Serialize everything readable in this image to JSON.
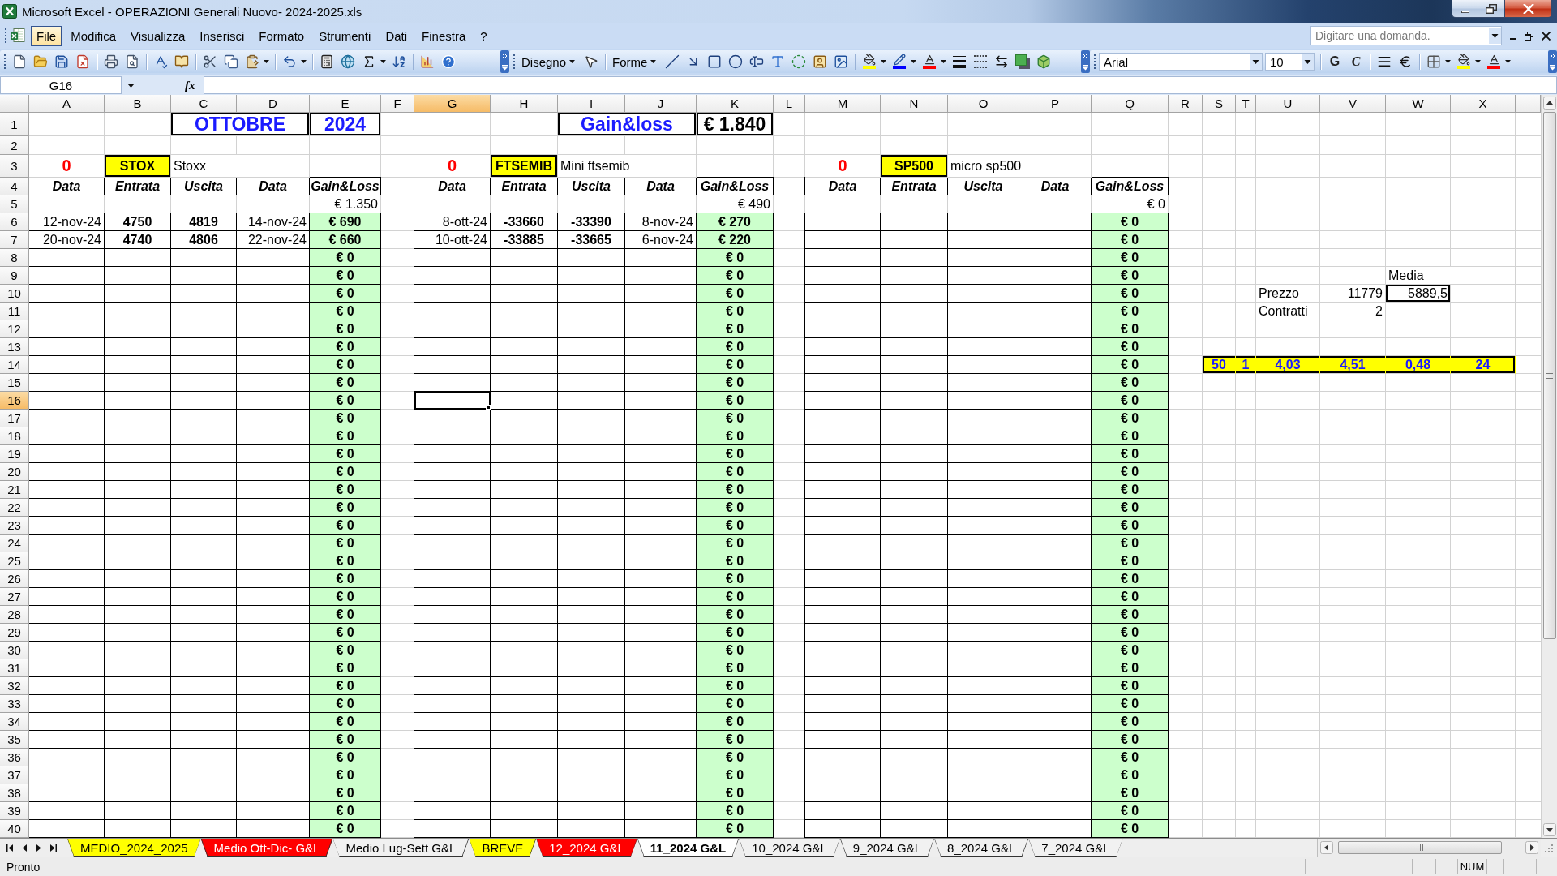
{
  "window": {
    "title": "Microsoft Excel - OPERAZIONI Generali Nuovo- 2024-2025.xls"
  },
  "menu": {
    "items": [
      {
        "label": "File",
        "selected": true
      },
      {
        "label": "Modifica",
        "selected": false
      },
      {
        "label": "Visualizza",
        "selected": false
      },
      {
        "label": "Inserisci",
        "selected": false
      },
      {
        "label": "Formato",
        "selected": false
      },
      {
        "label": "Strumenti",
        "selected": false
      },
      {
        "label": "Dati",
        "selected": false
      },
      {
        "label": "Finestra",
        "selected": false
      },
      {
        "label": "?",
        "selected": false
      }
    ],
    "help": {
      "placeholder": "Digitare una domanda."
    }
  },
  "drawing_toolbar": {
    "menus": [
      "Disegno",
      "Forme"
    ]
  },
  "formatting_toolbar": {
    "font": "Arial",
    "size": "10",
    "bold": "G",
    "italic": "C"
  },
  "formula_bar": {
    "name_box": "G16",
    "function_label": "fx"
  },
  "sheet": {
    "columns": [
      {
        "label": "A",
        "selected": false
      },
      {
        "label": "B",
        "selected": false
      },
      {
        "label": "C",
        "selected": false
      },
      {
        "label": "D",
        "selected": false
      },
      {
        "label": "E",
        "selected": false
      },
      {
        "label": "F",
        "selected": false
      },
      {
        "label": "G",
        "selected": true
      },
      {
        "label": "H",
        "selected": false
      },
      {
        "label": "I",
        "selected": false
      },
      {
        "label": "J",
        "selected": false
      },
      {
        "label": "K",
        "selected": false
      },
      {
        "label": "L",
        "selected": false
      },
      {
        "label": "M",
        "selected": false
      },
      {
        "label": "N",
        "selected": false
      },
      {
        "label": "O",
        "selected": false
      },
      {
        "label": "P",
        "selected": false
      },
      {
        "label": "Q",
        "selected": false
      },
      {
        "label": "R",
        "selected": false
      },
      {
        "label": "S",
        "selected": false
      },
      {
        "label": "T",
        "selected": false
      },
      {
        "label": "U",
        "selected": false
      },
      {
        "label": "V",
        "selected": false
      },
      {
        "label": "W",
        "selected": false
      },
      {
        "label": "X",
        "selected": false
      }
    ],
    "rows": [
      {
        "label": "1",
        "selected": false
      },
      {
        "label": "2",
        "selected": false
      },
      {
        "label": "3",
        "selected": false
      },
      {
        "label": "4",
        "selected": false
      },
      {
        "label": "5",
        "selected": false
      },
      {
        "label": "6",
        "selected": false
      },
      {
        "label": "7",
        "selected": false
      },
      {
        "label": "8",
        "selected": false
      },
      {
        "label": "9",
        "selected": false
      },
      {
        "label": "10",
        "selected": false
      },
      {
        "label": "11",
        "selected": false
      },
      {
        "label": "12",
        "selected": false
      },
      {
        "label": "13",
        "selected": false
      },
      {
        "label": "14",
        "selected": false
      },
      {
        "label": "15",
        "selected": false
      },
      {
        "label": "16",
        "selected": true
      },
      {
        "label": "17",
        "selected": false
      },
      {
        "label": "18",
        "selected": false
      },
      {
        "label": "19",
        "selected": false
      },
      {
        "label": "20",
        "selected": false
      },
      {
        "label": "21",
        "selected": false
      },
      {
        "label": "22",
        "selected": false
      },
      {
        "label": "23",
        "selected": false
      },
      {
        "label": "24",
        "selected": false
      },
      {
        "label": "25",
        "selected": false
      },
      {
        "label": "26",
        "selected": false
      },
      {
        "label": "27",
        "selected": false
      },
      {
        "label": "28",
        "selected": false
      },
      {
        "label": "29",
        "selected": false
      },
      {
        "label": "30",
        "selected": false
      },
      {
        "label": "31",
        "selected": false
      },
      {
        "label": "32",
        "selected": false
      },
      {
        "label": "33",
        "selected": false
      },
      {
        "label": "34",
        "selected": false
      },
      {
        "label": "35",
        "selected": false
      },
      {
        "label": "36",
        "selected": false
      },
      {
        "label": "37",
        "selected": false
      },
      {
        "label": "38",
        "selected": false
      },
      {
        "label": "39",
        "selected": false
      },
      {
        "label": "40",
        "selected": false
      }
    ],
    "header": {
      "month": "OTTOBRE",
      "year": "2024",
      "label": "Gain&loss",
      "total": "€ 1.840"
    },
    "tables": [
      {
        "count": "0",
        "ticker": "STOX",
        "name": "Stoxx",
        "headings": [
          "Data",
          "Entrata",
          "Uscita",
          "Data",
          "Gain&Loss"
        ],
        "total": "€ 1.350",
        "rows": [
          {
            "open_date": "12-nov-24",
            "entry": "4750",
            "exit": "4819",
            "close_date": "14-nov-24",
            "result": "€ 690"
          },
          {
            "open_date": "20-nov-24",
            "entry": "4740",
            "exit": "4806",
            "close_date": "22-nov-24",
            "result": "€ 660"
          },
          {
            "result": "€ 0"
          },
          {
            "result": "€ 0"
          },
          {
            "result": "€ 0"
          },
          {
            "result": "€ 0"
          },
          {
            "result": "€ 0"
          },
          {
            "result": "€ 0"
          },
          {
            "result": "€ 0"
          },
          {
            "result": "€ 0"
          },
          {
            "result": "€ 0"
          },
          {
            "result": "€ 0"
          },
          {
            "result": "€ 0"
          },
          {
            "result": "€ 0"
          },
          {
            "result": "€ 0"
          },
          {
            "result": "€ 0"
          },
          {
            "result": "€ 0"
          },
          {
            "result": "€ 0"
          },
          {
            "result": "€ 0"
          },
          {
            "result": "€ 0"
          },
          {
            "result": "€ 0"
          },
          {
            "result": "€ 0"
          },
          {
            "result": "€ 0"
          },
          {
            "result": "€ 0"
          },
          {
            "result": "€ 0"
          },
          {
            "result": "€ 0"
          },
          {
            "result": "€ 0"
          },
          {
            "result": "€ 0"
          },
          {
            "result": "€ 0"
          },
          {
            "result": "€ 0"
          },
          {
            "result": "€ 0"
          },
          {
            "result": "€ 0"
          },
          {
            "result": "€ 0"
          },
          {
            "result": "€ 0"
          },
          {
            "result": "€ 0"
          }
        ]
      },
      {
        "count": "0",
        "ticker": "FTSEMIB",
        "name": "Mini ftsemib",
        "headings": [
          "Data",
          "Entrata",
          "Uscita",
          "Data",
          "Gain&Loss"
        ],
        "total": "€ 490",
        "rows": [
          {
            "open_date": "8-ott-24",
            "entry": "-33660",
            "exit": "-33390",
            "close_date": "8-nov-24",
            "result": "€ 270"
          },
          {
            "open_date": "10-ott-24",
            "entry": "-33885",
            "exit": "-33665",
            "close_date": "6-nov-24",
            "result": "€ 220"
          },
          {
            "result": "€ 0"
          },
          {
            "result": "€ 0"
          },
          {
            "result": "€ 0"
          },
          {
            "result": "€ 0"
          },
          {
            "result": "€ 0"
          },
          {
            "result": "€ 0"
          },
          {
            "result": "€ 0"
          },
          {
            "result": "€ 0"
          },
          {
            "result": "€ 0"
          },
          {
            "result": "€ 0"
          },
          {
            "result": "€ 0"
          },
          {
            "result": "€ 0"
          },
          {
            "result": "€ 0"
          },
          {
            "result": "€ 0"
          },
          {
            "result": "€ 0"
          },
          {
            "result": "€ 0"
          },
          {
            "result": "€ 0"
          },
          {
            "result": "€ 0"
          },
          {
            "result": "€ 0"
          },
          {
            "result": "€ 0"
          },
          {
            "result": "€ 0"
          },
          {
            "result": "€ 0"
          },
          {
            "result": "€ 0"
          },
          {
            "result": "€ 0"
          },
          {
            "result": "€ 0"
          },
          {
            "result": "€ 0"
          },
          {
            "result": "€ 0"
          },
          {
            "result": "€ 0"
          },
          {
            "result": "€ 0"
          },
          {
            "result": "€ 0"
          },
          {
            "result": "€ 0"
          },
          {
            "result": "€ 0"
          },
          {
            "result": "€ 0"
          }
        ]
      },
      {
        "count": "0",
        "ticker": "SP500",
        "name": "micro sp500",
        "headings": [
          "Data",
          "Entrata",
          "Uscita",
          "Data",
          "Gain&Loss"
        ],
        "total": "€ 0",
        "rows": [
          {
            "result": "€ 0"
          },
          {
            "result": "€ 0"
          },
          {
            "result": "€ 0"
          },
          {
            "result": "€ 0"
          },
          {
            "result": "€ 0"
          },
          {
            "result": "€ 0"
          },
          {
            "result": "€ 0"
          },
          {
            "result": "€ 0"
          },
          {
            "result": "€ 0"
          },
          {
            "result": "€ 0"
          },
          {
            "result": "€ 0"
          },
          {
            "result": "€ 0"
          },
          {
            "result": "€ 0"
          },
          {
            "result": "€ 0"
          },
          {
            "result": "€ 0"
          },
          {
            "result": "€ 0"
          },
          {
            "result": "€ 0"
          },
          {
            "result": "€ 0"
          },
          {
            "result": "€ 0"
          },
          {
            "result": "€ 0"
          },
          {
            "result": "€ 0"
          },
          {
            "result": "€ 0"
          },
          {
            "result": "€ 0"
          },
          {
            "result": "€ 0"
          },
          {
            "result": "€ 0"
          },
          {
            "result": "€ 0"
          },
          {
            "result": "€ 0"
          },
          {
            "result": "€ 0"
          },
          {
            "result": "€ 0"
          },
          {
            "result": "€ 0"
          },
          {
            "result": "€ 0"
          },
          {
            "result": "€ 0"
          },
          {
            "result": "€ 0"
          },
          {
            "result": "€ 0"
          },
          {
            "result": "€ 0"
          }
        ]
      }
    ],
    "calculator": {
      "heading": "Media",
      "rows": [
        {
          "label": "Prezzo",
          "value": "11779",
          "average": "5889,5"
        },
        {
          "label": "Contratti",
          "value": "2"
        }
      ]
    },
    "strip": [
      "50",
      "1",
      "4,03",
      "4,51",
      "0,48",
      "24"
    ]
  },
  "sheet_tabs": [
    {
      "label": "MEDIO_2024_2025",
      "selected": false,
      "color": "#ffff00"
    },
    {
      "label": "Medio Ott-Dic- G&L",
      "selected": false,
      "color": "#ff0000"
    },
    {
      "label": "Medio Lug-Sett G&L",
      "selected": false
    },
    {
      "label": "BREVE",
      "selected": false,
      "color": "#ffff00"
    },
    {
      "label": "12_2024 G&L",
      "selected": false,
      "color": "#ff0000"
    },
    {
      "label": "11_2024 G&L",
      "selected": true
    },
    {
      "label": "10_2024 G&L",
      "selected": false
    },
    {
      "label": "9_2024 G&L",
      "selected": false
    },
    {
      "label": "8_2024 G&L",
      "selected": false
    },
    {
      "label": "7_2024 G&L",
      "selected": false
    }
  ],
  "status_bar": {
    "text": "Pronto",
    "indicator": "NUM"
  }
}
